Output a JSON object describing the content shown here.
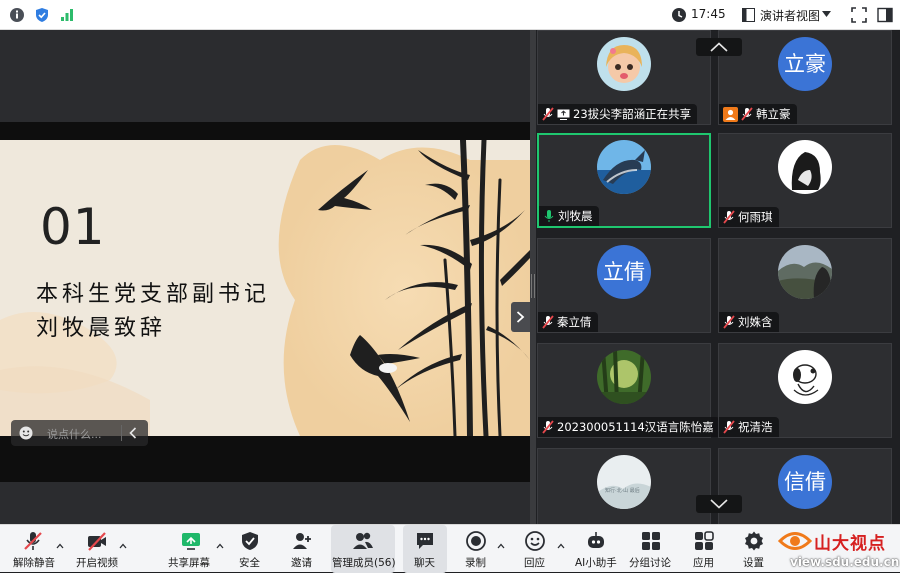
{
  "topbar": {
    "time": "17:45",
    "view_label": "演讲者视图",
    "icons": [
      "info-icon",
      "shield-icon",
      "signal-icon",
      "clock-icon",
      "layout-icon",
      "chevron-down-icon",
      "fullscreen-icon",
      "sidebar-toggle-icon"
    ]
  },
  "slide": {
    "number": "01",
    "line1": "本科生党支部副书记",
    "line2": "刘牧晨致辞",
    "comment_placeholder": "说点什么..."
  },
  "participants": [
    {
      "name": "23拔尖李韶涵正在共享",
      "avatar_type": "image",
      "avatar_kind": "cartoon-girl",
      "muted": true,
      "sharing": true
    },
    {
      "name": "韩立豪",
      "avatar_type": "text",
      "avatar_text": "立豪",
      "muted": true,
      "host_badge": true
    },
    {
      "name": "刘牧晨",
      "avatar_type": "image",
      "avatar_kind": "whale",
      "muted": false,
      "active": true
    },
    {
      "name": "何雨琪",
      "avatar_type": "image",
      "avatar_kind": "girl-silhouette",
      "muted": true
    },
    {
      "name": "秦立倩",
      "avatar_type": "text",
      "avatar_text": "立倩",
      "muted": true
    },
    {
      "name": "刘姝含",
      "avatar_type": "image",
      "avatar_kind": "landscape",
      "muted": true
    },
    {
      "name": "202300051114汉语言陈怡嘉",
      "avatar_type": "image",
      "avatar_kind": "forest",
      "muted": true
    },
    {
      "name": "祝清浩",
      "avatar_type": "image",
      "avatar_kind": "snoopy",
      "muted": true
    },
    {
      "name": "",
      "avatar_type": "image",
      "avatar_kind": "mist",
      "avatar_caption": "知行·北·山 最后",
      "muted": true
    },
    {
      "name": "",
      "avatar_type": "text",
      "avatar_text": "信倩",
      "muted": true
    }
  ],
  "toolbar": {
    "items": [
      {
        "label": "解除静音",
        "icon": "mic-muted-icon"
      },
      {
        "label": "开启视频",
        "icon": "camera-off-icon"
      },
      {
        "label": "共享屏幕",
        "icon": "share-screen-icon"
      },
      {
        "label": "安全",
        "icon": "shield-icon"
      },
      {
        "label": "邀请",
        "icon": "add-user-icon"
      },
      {
        "label": "管理成员(56)",
        "icon": "members-icon"
      },
      {
        "label": "聊天",
        "icon": "chat-icon"
      },
      {
        "label": "录制",
        "icon": "record-icon"
      },
      {
        "label": "回应",
        "icon": "emoji-icon"
      },
      {
        "label": "AI小助手",
        "icon": "ai-assistant-icon"
      },
      {
        "label": "分组讨论",
        "icon": "breakout-icon"
      },
      {
        "label": "应用",
        "icon": "apps-icon"
      },
      {
        "label": "设置",
        "icon": "gear-icon"
      }
    ]
  },
  "watermark": {
    "text": "山大视点",
    "url": "view.sdu.edu.cn"
  },
  "colors": {
    "active_border": "#1fc76f",
    "avatar_blue": "#3b74d6",
    "muted_red": "#e5484d",
    "brand_orange": "#f07a1a"
  }
}
